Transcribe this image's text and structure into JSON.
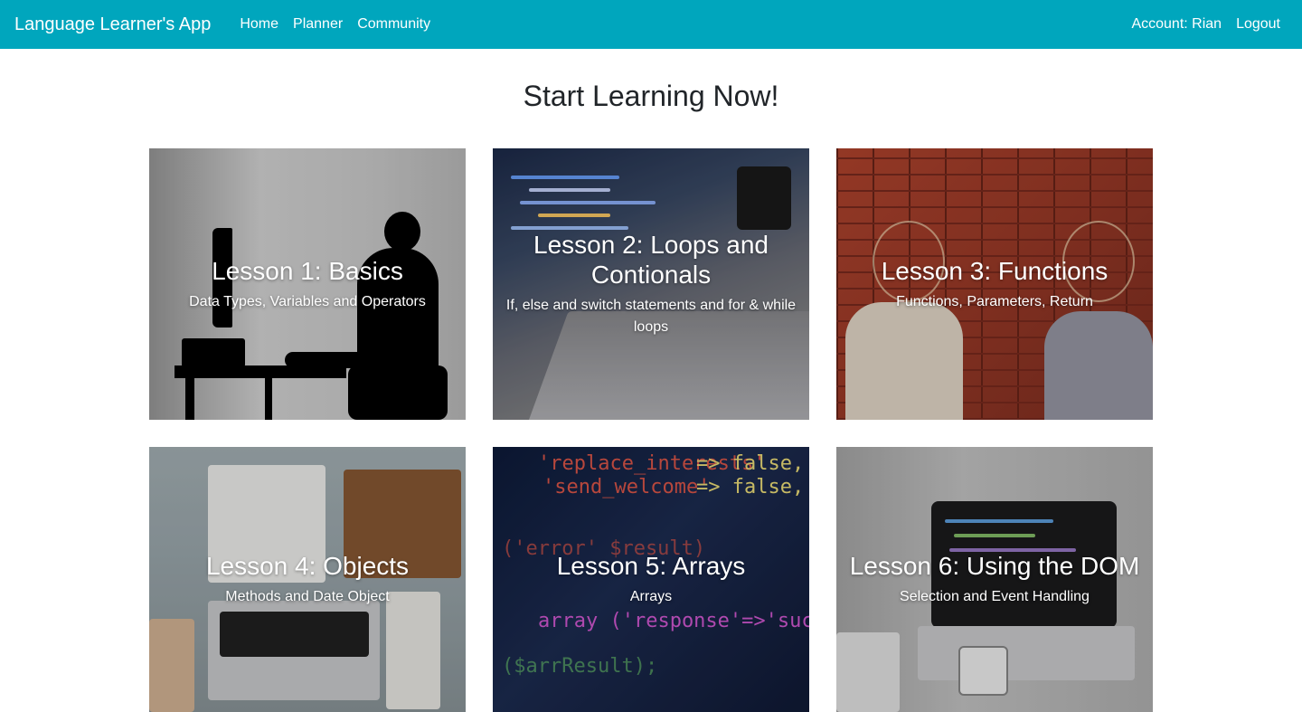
{
  "navbar": {
    "brand": "Language Learner's App",
    "links": [
      {
        "label": "Home"
      },
      {
        "label": "Planner"
      },
      {
        "label": "Community"
      }
    ],
    "account": "Account: Rian",
    "logout": "Logout",
    "color": "#00a6bd"
  },
  "page": {
    "title": "Start Learning Now!"
  },
  "lessons": [
    {
      "title": "Lesson 1: Basics",
      "subtitle": "Data Types, Variables and Operators"
    },
    {
      "title": "Lesson 2: Loops and Contionals",
      "subtitle": "If, else and switch statements and for & while loops"
    },
    {
      "title": "Lesson 3: Functions",
      "subtitle": "Functions, Parameters, Return"
    },
    {
      "title": "Lesson 4: Objects",
      "subtitle": "Methods and Date Object"
    },
    {
      "title": "Lesson 5: Arrays",
      "subtitle": "Arrays"
    },
    {
      "title": "Lesson 6: Using the DOM",
      "subtitle": "Selection and Event Handling"
    }
  ]
}
